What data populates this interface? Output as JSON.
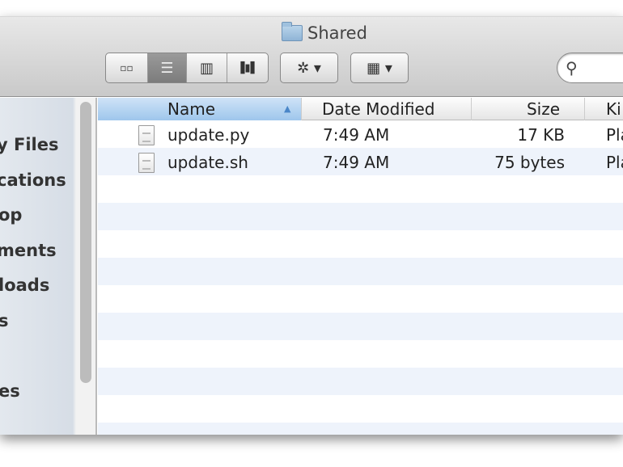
{
  "window": {
    "title": "Shared"
  },
  "toolbar": {
    "view_buttons": [
      {
        "name": "icon-view",
        "glyph": "▫▫"
      },
      {
        "name": "list-view",
        "glyph": "☰"
      },
      {
        "name": "column-view",
        "glyph": "▥"
      },
      {
        "name": "coverflow-view",
        "glyph": "▐▮▌"
      }
    ],
    "action_glyph": "✲ ▾",
    "arrange_glyph": "▦ ▾",
    "search_glyph": "⚲"
  },
  "sidebar": {
    "items": [
      "y Files",
      "cations",
      "op",
      "ments",
      "loads",
      "s",
      "",
      "es"
    ]
  },
  "columns": {
    "name": "Name",
    "sort_indicator": "▲",
    "date": "Date Modified",
    "size": "Size",
    "kind": "Ki"
  },
  "files": [
    {
      "name": "update.py",
      "date": "7:49 AM",
      "size": "17 KB",
      "kind": "Pla"
    },
    {
      "name": "update.sh",
      "date": "7:49 AM",
      "size": "75 bytes",
      "kind": "Pla"
    }
  ]
}
